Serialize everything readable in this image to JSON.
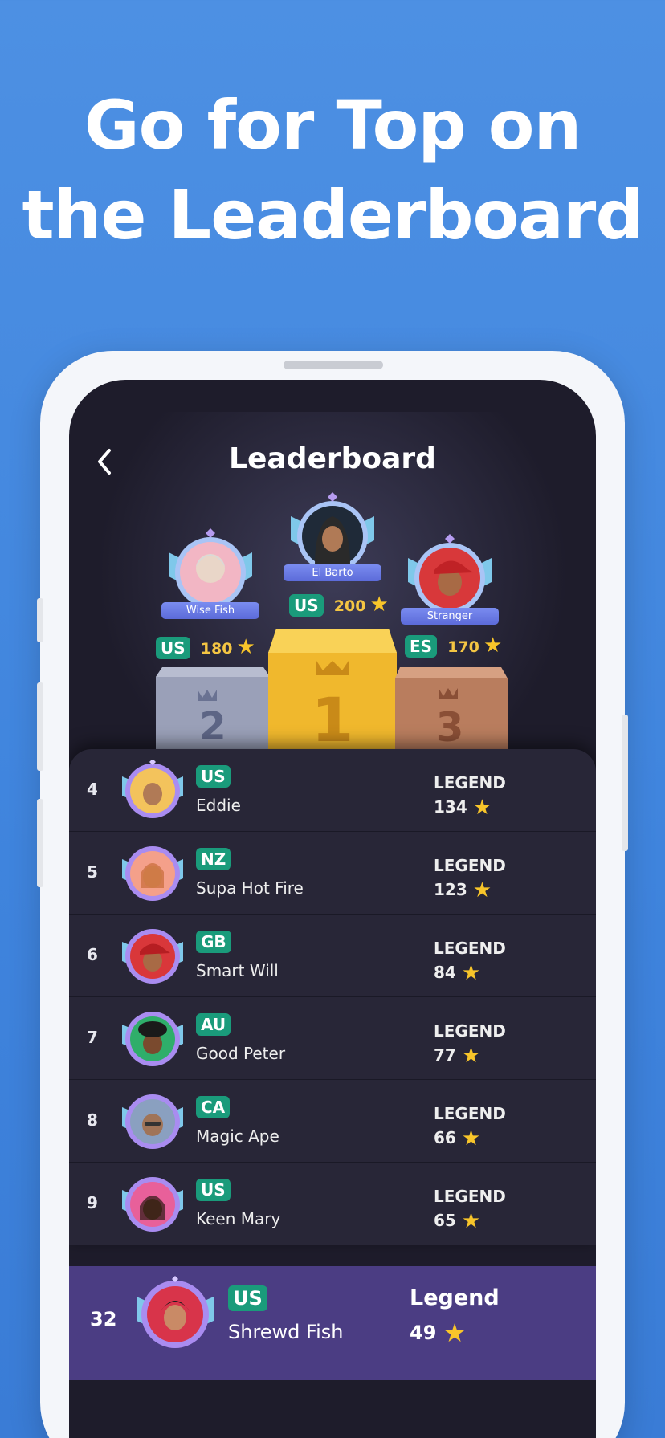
{
  "headline": {
    "line1": "Go for Top on",
    "line2": "the Leaderboard"
  },
  "screen": {
    "title": "Leaderboard",
    "back_icon": "chevron-left-icon"
  },
  "podium": [
    {
      "place": "1",
      "name": "El Barto",
      "country": "US",
      "score": "200",
      "avatar_color": "#1f2a38",
      "block_color": "#f0b82d"
    },
    {
      "place": "2",
      "name": "Wise Fish",
      "country": "US",
      "score": "180",
      "avatar_color": "#f2b6c4",
      "block_color": "#9aa0b8"
    },
    {
      "place": "3",
      "name": "Stranger",
      "country": "ES",
      "score": "170",
      "avatar_color": "#d8383a",
      "block_color": "#c18a6a"
    }
  ],
  "rows": [
    {
      "rank": "4",
      "country": "US",
      "name": "Eddie",
      "tier": "LEGEND",
      "points": "134",
      "avatar_color": "#f3c35c"
    },
    {
      "rank": "5",
      "country": "NZ",
      "name": "Supa Hot Fire",
      "tier": "LEGEND",
      "points": "123",
      "avatar_color": "#f4a08a"
    },
    {
      "rank": "6",
      "country": "GB",
      "name": "Smart Will",
      "tier": "LEGEND",
      "points": "84",
      "avatar_color": "#d9373a"
    },
    {
      "rank": "7",
      "country": "AU",
      "name": "Good Peter",
      "tier": "LEGEND",
      "points": "77",
      "avatar_color": "#2fae6a"
    },
    {
      "rank": "8",
      "country": "CA",
      "name": "Magic Ape",
      "tier": "LEGEND",
      "points": "66",
      "avatar_color": "#8aa0c0"
    },
    {
      "rank": "9",
      "country": "US",
      "name": "Keen Mary",
      "tier": "LEGEND",
      "points": "65",
      "avatar_color": "#e8609a"
    }
  ],
  "current_user": {
    "rank": "32",
    "country": "US",
    "name": "Shrewd Fish",
    "tier": "Legend",
    "points": "49",
    "avatar_color": "#d8344a"
  },
  "colors": {
    "background": "#4d90e3",
    "screen": "#1e1c2b",
    "list": "#282637",
    "highlight_row": "#4b3d83",
    "flag": "#1a9b7b",
    "star": "#f8c52a"
  }
}
